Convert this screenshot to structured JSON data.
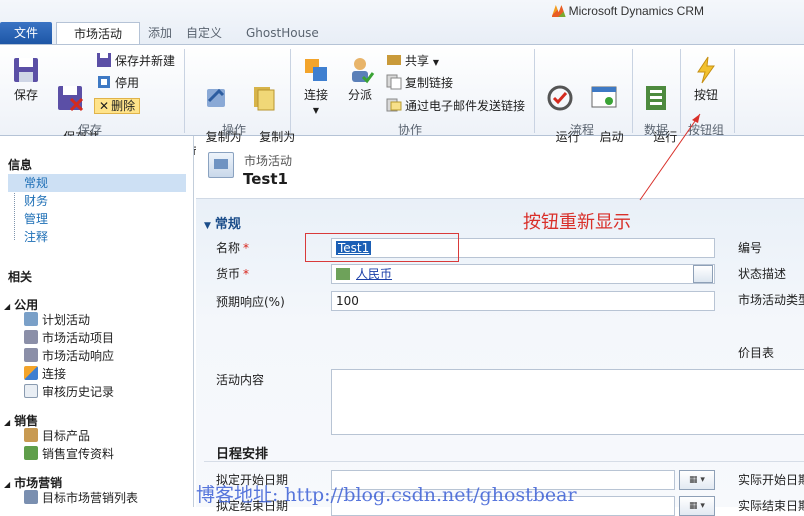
{
  "app": {
    "brand": "Microsoft Dynamics CRM"
  },
  "tabs": [
    "文件",
    "市场活动",
    "添加",
    "自定义",
    "GhostHouse"
  ],
  "ribbon": {
    "save": {
      "save": "保存",
      "save_close": "保存并\n关闭",
      "save_new": "保存并新建",
      "deactivate": "停用",
      "delete": "删除",
      "group": "保存"
    },
    "ops": {
      "copy_campaign": "复制为\n市场活动",
      "copy_template": "复制为\n模板",
      "group": "操作"
    },
    "collab": {
      "connect": "连接",
      "assign": "分派",
      "share": "共享",
      "copy_link": "复制链接",
      "email_link": "通过电子邮件发送链接",
      "group": "协作"
    },
    "process": {
      "run_workflow": "运行\n工作流",
      "start_dialog": "启动\n脚本",
      "group": "流程"
    },
    "data": {
      "run_report": "运行\n报表",
      "group": "数据"
    },
    "btngroup": {
      "button": "按钮",
      "group": "按钮组"
    }
  },
  "nav": {
    "info_header": "信息",
    "info_items": [
      "常规",
      "财务",
      "管理",
      "注释"
    ],
    "related_header": "相关",
    "sections": [
      {
        "title": "公用",
        "items": [
          "计划活动",
          "市场活动项目",
          "市场活动响应",
          "连接",
          "审核历史记录"
        ]
      },
      {
        "title": "销售",
        "items": [
          "目标产品",
          "销售宣传资料"
        ]
      },
      {
        "title": "市场营销",
        "items": [
          "目标市场营销列表"
        ]
      }
    ]
  },
  "header": {
    "entity": "市场活动",
    "record": "Test1"
  },
  "form": {
    "section_general": "常规",
    "name_label": "名称",
    "name_value": "Test1",
    "currency_label": "货币",
    "currency_value": "人民币",
    "response_label": "预期响应(%)",
    "response_value": "100",
    "number_label": "编号",
    "status_label": "状态描述",
    "type_label": "市场活动类型",
    "pricelist_label": "价目表",
    "content_label": "活动内容",
    "schedule_title": "日程安排",
    "planned_start_label": "拟定开始日期",
    "planned_end_label": "拟定结束日期",
    "actual_start_label": "实际开始日期",
    "actual_end_label": "实际结束日期"
  },
  "annotation": {
    "text": "按钮重新显示"
  },
  "watermark": "博客地址: http://blog.csdn.net/ghostbear",
  "colors": {
    "accent": "#1d56a6",
    "annotation": "#d9302a",
    "required": "#d8241b"
  }
}
